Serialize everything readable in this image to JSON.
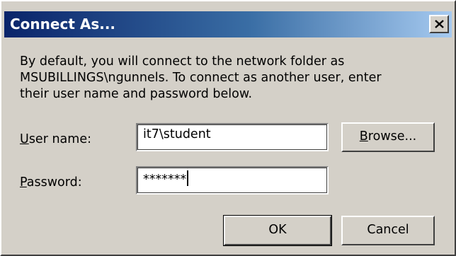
{
  "window": {
    "title": "Connect As..."
  },
  "message": {
    "line1": "By default, you will connect to the network folder as",
    "line2": "MSUBILLINGS\\ngunnels. To connect as another user, enter",
    "line3": "their user name and password below."
  },
  "form": {
    "username": {
      "label_mnemonic": "U",
      "label_rest": "ser name:",
      "value": "it7\\student"
    },
    "password": {
      "label_mnemonic": "P",
      "label_rest": "assword:",
      "value": "*******"
    }
  },
  "buttons": {
    "browse_mnemonic": "B",
    "browse_rest": "rowse...",
    "ok": "OK",
    "cancel": "Cancel"
  },
  "icons": {
    "close": "close-icon"
  },
  "colors": {
    "titlebar_start": "#0a246a",
    "titlebar_end": "#a6caf0",
    "dialog_face": "#d4d0c8"
  }
}
